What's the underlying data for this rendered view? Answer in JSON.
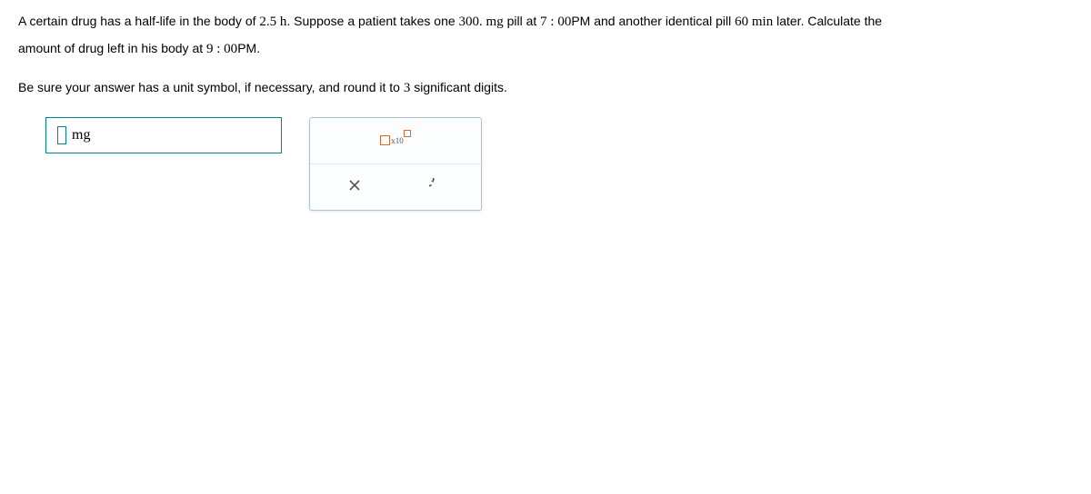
{
  "question": {
    "line1_part1": "A certain drug has a half-life in the body of ",
    "halflife": "2.5 h",
    "line1_part2": ". Suppose a patient takes one ",
    "dose": "300. mg",
    "line1_part3": " pill at ",
    "time1": "7 : 00",
    "time1_suffix": "PM and another identical pill ",
    "interval": "60 min",
    "line1_part4": " later. Calculate the",
    "line2_part1": "amount of drug left in his body at ",
    "time2": "9 : 00",
    "time2_suffix": "PM.",
    "line3": "Be sure your answer has a unit symbol, if necessary, and round it to ",
    "sigfigs": "3",
    "line3_part2": " significant digits."
  },
  "answer": {
    "unit_label": "mg"
  },
  "tools": {
    "sci_label": "x10",
    "clear_label": "clear",
    "reset_label": "reset"
  }
}
